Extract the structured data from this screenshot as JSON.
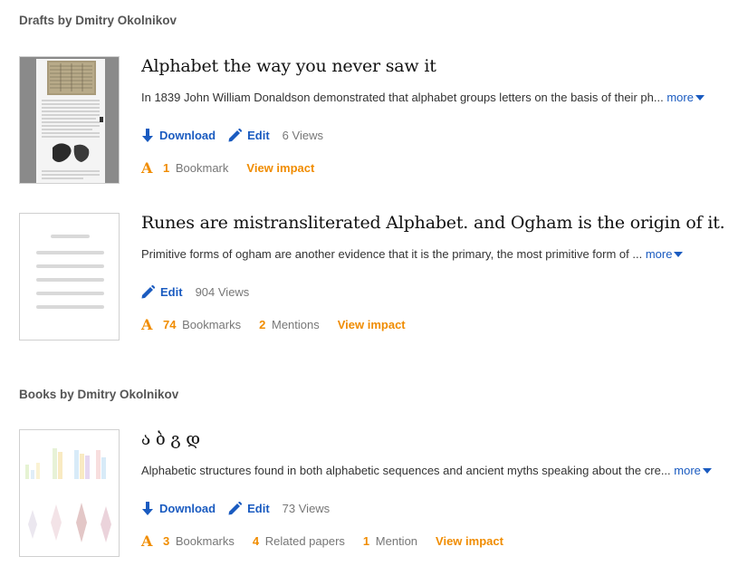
{
  "drafts": {
    "heading": "Drafts by Dmitry Okolnikov",
    "items": [
      {
        "title": "Alphabet the way you never saw it",
        "summary": "In 1839 John William Donaldson demonstrated that alphabet groups letters on the basis of their ph...",
        "more_label": "more",
        "download_label": "Download",
        "edit_label": "Edit",
        "views": "6 Views",
        "bookmarks_count": "1",
        "bookmarks_label": "Bookmark",
        "impact_label": "View impact"
      },
      {
        "title": "Runes are mistransliterated Alphabet. and Ogham is the origin of it.",
        "summary": "Primitive forms of ogham are another evidence that it is the primary, the most primitive form of ...",
        "more_label": "more",
        "edit_label": "Edit",
        "views": "904 Views",
        "bookmarks_count": "74",
        "bookmarks_label": "Bookmarks",
        "mentions_count": "2",
        "mentions_label": "Mentions",
        "impact_label": "View impact"
      }
    ]
  },
  "books": {
    "heading": "Books by Dmitry Okolnikov",
    "items": [
      {
        "title": "ა ბ გ დ",
        "summary": "Alphabetic structures found in both alphabetic sequences and ancient myths speaking about the cre...",
        "more_label": "more",
        "download_label": "Download",
        "edit_label": "Edit",
        "views": "73 Views",
        "bookmarks_count": "3",
        "bookmarks_label": "Bookmarks",
        "related_count": "4",
        "related_label": "Related papers",
        "mentions_count": "1",
        "mentions_label": "Mention",
        "impact_label": "View impact"
      }
    ]
  },
  "icons": {
    "download": "download-arrow-icon",
    "edit": "pencil-icon",
    "academia": "academia-a-icon",
    "more": "caret-down-icon"
  },
  "colors": {
    "link_blue": "#1a5bc0",
    "accent_orange": "#f08c00",
    "heading_gray": "#555555"
  }
}
